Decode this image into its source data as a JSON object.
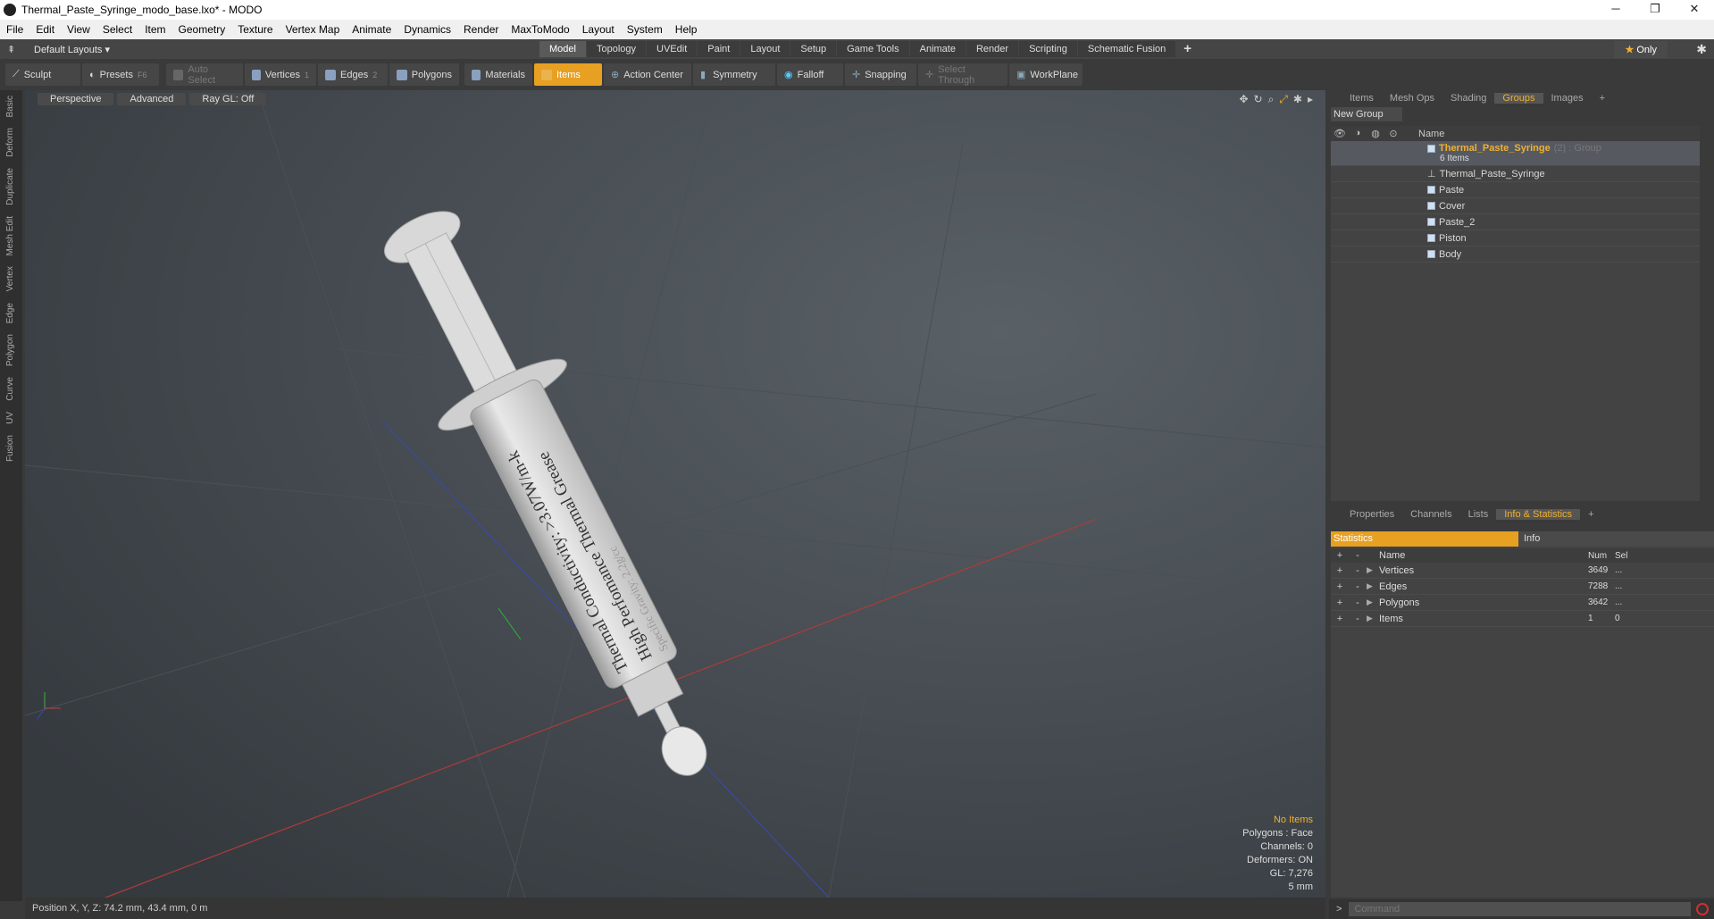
{
  "window": {
    "title": "Thermal_Paste_Syringe_modo_base.lxo* - MODO"
  },
  "menu": [
    "File",
    "Edit",
    "View",
    "Select",
    "Item",
    "Geometry",
    "Texture",
    "Vertex Map",
    "Animate",
    "Dynamics",
    "Render",
    "MaxToModo",
    "Layout",
    "System",
    "Help"
  ],
  "layouts": {
    "label": "Default Layouts ▾",
    "tabs": [
      "Model",
      "Topology",
      "UVEdit",
      "Paint",
      "Layout",
      "Setup",
      "Game Tools",
      "Animate",
      "Render",
      "Scripting",
      "Schematic Fusion"
    ],
    "active": "Model",
    "only": "Only"
  },
  "toolbar": {
    "sculpt": "Sculpt",
    "presets": "Presets",
    "presets_key": "F6",
    "auto_select": "Auto Select",
    "vertices": "Vertices",
    "vertices_n": "1",
    "edges": "Edges",
    "edges_n": "2",
    "polygons": "Polygons",
    "materials": "Materials",
    "items": "Items",
    "action_center": "Action Center",
    "symmetry": "Symmetry",
    "falloff": "Falloff",
    "snapping": "Snapping",
    "select_through": "Select Through",
    "workplane": "WorkPlane"
  },
  "left_tabs": [
    "Basic",
    "Deform",
    "Duplicate",
    "Mesh Edit",
    "Vertex",
    "Edge",
    "Polygon",
    "Curve",
    "UV",
    "Fusion"
  ],
  "viewport": {
    "perspective": "Perspective",
    "advanced": "Advanced",
    "raygl": "Ray GL: Off",
    "info": {
      "no_items": "No Items",
      "polygons": "Polygons : Face",
      "channels": "Channels: 0",
      "deformers": "Deformers: ON",
      "gl": "GL: 7,276",
      "scale": "5 mm"
    },
    "label_line1": "Thermal Conductivity: >3.07W/m-k",
    "label_line2": "High Perfomance Thermal Grease",
    "label_line3": "Specific Gravity: 2.2g/cc"
  },
  "status": {
    "position": "Position X, Y, Z:   74.2 mm, 43.4 mm, 0 m"
  },
  "groups_panel": {
    "tabs": [
      "Items",
      "Mesh Ops",
      "Shading",
      "Groups",
      "Images"
    ],
    "active": "Groups",
    "new_group": "New Group",
    "name_col": "Name",
    "group": {
      "name": "Thermal_Paste_Syringe",
      "suffix": "(2) : Group",
      "count": "6 Items"
    },
    "items": [
      "Thermal_Paste_Syringe",
      "Paste",
      "Cover",
      "Paste_2",
      "Piston",
      "Body"
    ]
  },
  "props_panel": {
    "tabs": [
      "Properties",
      "Channels",
      "Lists",
      "Info & Statistics"
    ],
    "active": "Info & Statistics",
    "statistics": "Statistics",
    "info": "Info",
    "cols": {
      "name": "Name",
      "num": "Num",
      "sel": "Sel"
    },
    "rows": [
      {
        "name": "Vertices",
        "num": "3649",
        "sel": "..."
      },
      {
        "name": "Edges",
        "num": "7288",
        "sel": "..."
      },
      {
        "name": "Polygons",
        "num": "3642",
        "sel": "..."
      },
      {
        "name": "Items",
        "num": "1",
        "sel": "0"
      }
    ]
  },
  "command": {
    "placeholder": "Command"
  }
}
